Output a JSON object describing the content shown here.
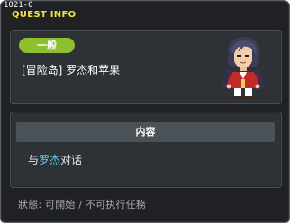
{
  "window": {
    "quest_id": "1021-0",
    "title": "QUEST INFO"
  },
  "quest": {
    "category": "一般",
    "name": "[冒险岛] 罗杰和苹果"
  },
  "content": {
    "header": "内容",
    "detail_prefix": "与",
    "detail_npc": "罗杰",
    "detail_suffix": "对话"
  },
  "status": {
    "text": "狀態: 可開始 / 不可执行任務"
  },
  "colors": {
    "category_badge": "#8dbf2f",
    "title": "#f2e33a",
    "npc_highlight": "#5fd0f0"
  },
  "icons": {
    "npc_portrait": "npc-roger-portrait"
  }
}
